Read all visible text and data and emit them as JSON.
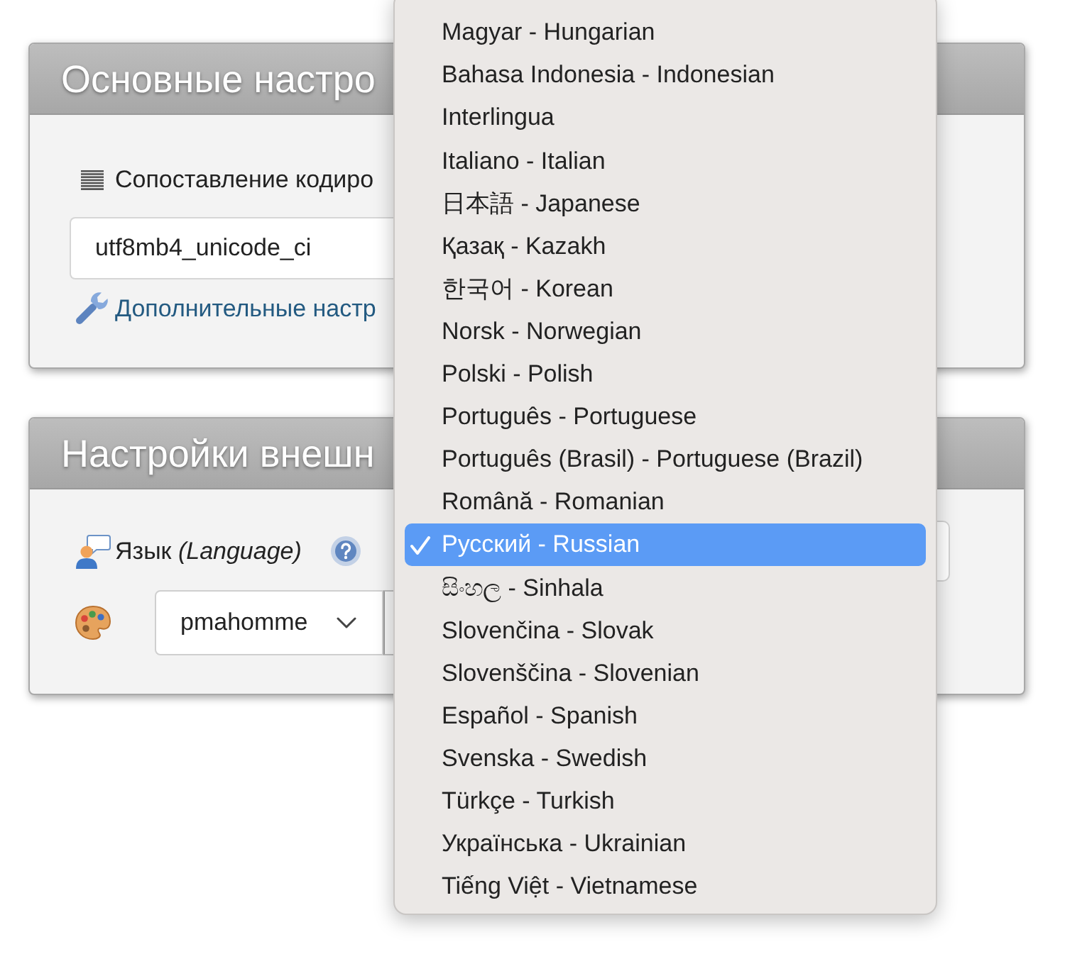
{
  "panels": [
    {
      "title": "Основные настро",
      "collation": {
        "label": "Сопоставление кодиро",
        "value": "utf8mb4_unicode_ci"
      },
      "more_settings_link": "Дополнительные настр"
    },
    {
      "title": "Настройки внешн",
      "language": {
        "label": "Язык *(Language)*"
      },
      "theme": {
        "value": "pmahomme"
      }
    }
  ],
  "language_dropdown": {
    "options": [
      {
        "label": "Magyar - Hungarian",
        "selected": false
      },
      {
        "label": "Bahasa Indonesia - Indonesian",
        "selected": false
      },
      {
        "label": "Interlingua",
        "selected": false
      },
      {
        "label": "Italiano - Italian",
        "selected": false
      },
      {
        "label": "日本語 - Japanese",
        "selected": false
      },
      {
        "label": "Қазақ - Kazakh",
        "selected": false
      },
      {
        "label": "한국어 - Korean",
        "selected": false
      },
      {
        "label": "Norsk - Norwegian",
        "selected": false
      },
      {
        "label": "Polski - Polish",
        "selected": false
      },
      {
        "label": "Português - Portuguese",
        "selected": false
      },
      {
        "label": "Português (Brasil) - Portuguese (Brazil)",
        "selected": false
      },
      {
        "label": "Română - Romanian",
        "selected": false
      },
      {
        "label": "Русский - Russian",
        "selected": true
      },
      {
        "label": "සිංහල - Sinhala",
        "selected": false
      },
      {
        "label": "Slovenčina - Slovak",
        "selected": false
      },
      {
        "label": "Slovenščina - Slovenian",
        "selected": false
      },
      {
        "label": "Español - Spanish",
        "selected": false
      },
      {
        "label": "Svenska - Swedish",
        "selected": false
      },
      {
        "label": "Türkçe - Turkish",
        "selected": false
      },
      {
        "label": "Українська - Ukrainian",
        "selected": false
      },
      {
        "label": "Tiếng Việt - Vietnamese",
        "selected": false
      }
    ]
  }
}
